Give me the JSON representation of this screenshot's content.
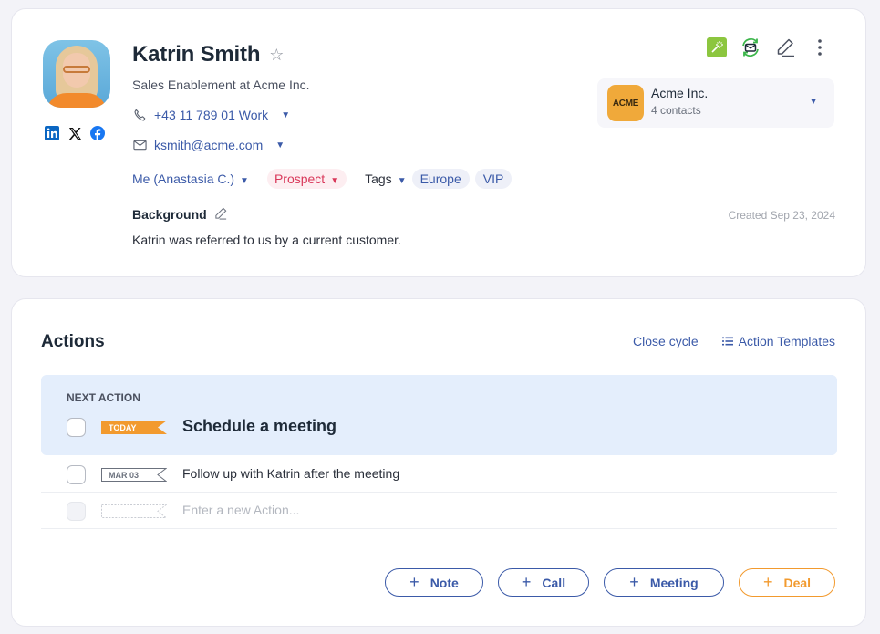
{
  "contact": {
    "name": "Katrin Smith",
    "job": "Sales Enablement at Acme Inc.",
    "phone": "+43 11 789 01 Work",
    "email": "ksmith@acme.com",
    "owner": "Me (Anastasia C.)",
    "status": "Prospect",
    "tags_label": "Tags",
    "tags": [
      "Europe",
      "VIP"
    ],
    "background_title": "Background",
    "background_text": "Katrin was referred to us by a current customer.",
    "created": "Created Sep 23, 2024",
    "socials": [
      "linkedin-icon",
      "x-icon",
      "facebook-icon"
    ]
  },
  "company": {
    "logo_text": "ACME",
    "name": "Acme Inc.",
    "contacts": "4 contacts"
  },
  "actions": {
    "title": "Actions",
    "close_cycle": "Close cycle",
    "templates": "Action Templates",
    "next_label": "NEXT ACTION",
    "next": {
      "badge": "TODAY",
      "text": "Schedule a meeting"
    },
    "items": [
      {
        "badge": "MAR 03",
        "text": "Follow up with Katrin after the meeting"
      }
    ],
    "new_placeholder": "Enter a new Action...",
    "buttons": {
      "note": "Note",
      "call": "Call",
      "meeting": "Meeting",
      "deal": "Deal"
    }
  },
  "colors": {
    "accent": "#3b5aa8",
    "prospect": "#d9385a",
    "today": "#f29a2e",
    "next_bg": "#e4eefc"
  }
}
